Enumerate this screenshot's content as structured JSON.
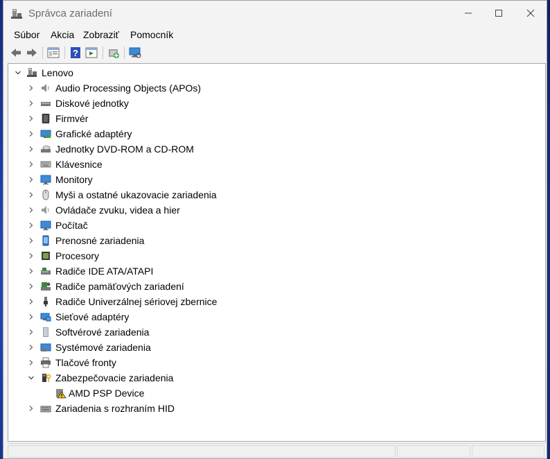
{
  "window": {
    "title": "Správca zariadení"
  },
  "menu": [
    "Súbor",
    "Akcia",
    "Zobraziť",
    "Pomocník"
  ],
  "toolbar": [
    "back-icon",
    "forward-icon",
    "properties-view-icon",
    "help-icon",
    "run-view-icon",
    "update-driver-icon",
    "scan-hardware-icon"
  ],
  "tree": {
    "root": "Lenovo",
    "items": [
      {
        "label": "Audio Processing Objects (APOs)",
        "icon": "speaker-icon"
      },
      {
        "label": "Diskové jednotky",
        "icon": "disk-drive-icon"
      },
      {
        "label": "Firmvér",
        "icon": "firmware-icon"
      },
      {
        "label": "Grafické adaptéry",
        "icon": "display-adapter-icon"
      },
      {
        "label": "Jednotky DVD-ROM a CD-ROM",
        "icon": "dvd-drive-icon"
      },
      {
        "label": "Klávesnice",
        "icon": "keyboard-icon"
      },
      {
        "label": "Monitory",
        "icon": "monitor-icon"
      },
      {
        "label": "Myši a ostatné ukazovacie zariadenia",
        "icon": "mouse-icon"
      },
      {
        "label": "Ovládače zvuku, videa a hier",
        "icon": "sound-icon"
      },
      {
        "label": "Počítač",
        "icon": "computer-icon"
      },
      {
        "label": "Prenosné zariadenia",
        "icon": "portable-device-icon"
      },
      {
        "label": "Procesory",
        "icon": "processor-icon"
      },
      {
        "label": "Radiče IDE ATA/ATAPI",
        "icon": "ide-controller-icon"
      },
      {
        "label": "Radiče pamäťových zariadení",
        "icon": "storage-controller-icon"
      },
      {
        "label": "Radiče Univerzálnej sériovej zbernice",
        "icon": "usb-icon"
      },
      {
        "label": "Sieťové adaptéry",
        "icon": "network-adapter-icon"
      },
      {
        "label": "Softvérové zariadenia",
        "icon": "software-device-icon"
      },
      {
        "label": "Systémové zariadenia",
        "icon": "system-device-icon"
      },
      {
        "label": "Tlačové fronty",
        "icon": "printer-icon"
      },
      {
        "label": "Zabezpečovacie zariadenia",
        "icon": "security-device-icon",
        "expanded": true
      },
      {
        "label": "AMD PSP Device",
        "icon": "warning-device-icon",
        "child": true
      },
      {
        "label": "Zariadenia s rozhraním HID",
        "icon": "hid-icon"
      }
    ]
  }
}
